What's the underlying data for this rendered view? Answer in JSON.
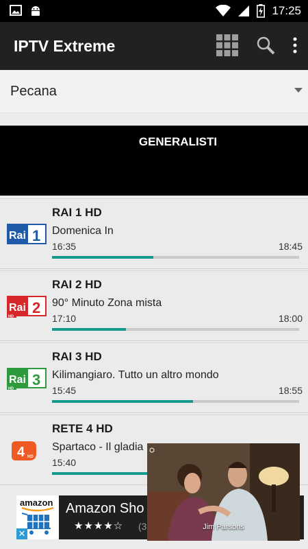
{
  "status_bar": {
    "time": "17:25",
    "icons": [
      "image-icon",
      "android-icon",
      "wifi-icon",
      "signal-icon",
      "battery-charging-icon"
    ]
  },
  "app_bar": {
    "title": "IPTV Extreme",
    "actions": [
      "grid-view-icon",
      "search-icon",
      "overflow-menu-icon"
    ]
  },
  "spinner": {
    "selected": "Pecana"
  },
  "category": {
    "title": "GENERALISTI"
  },
  "channels": [
    {
      "logo": "Rai 1",
      "name": "RAI 1 HD",
      "program": "Domenica In",
      "start": "16:35",
      "end": "18:45",
      "progress": 0.41
    },
    {
      "logo": "Rai 2",
      "name": "RAI 2 HD",
      "program": "90° Minuto Zona mista",
      "start": "17:10",
      "end": "18:00",
      "progress": 0.3
    },
    {
      "logo": "Rai 3",
      "name": "RAI 3 HD",
      "program": "Kilimangiaro. Tutto un altro mondo",
      "start": "15:45",
      "end": "18:55",
      "progress": 0.57
    },
    {
      "logo": "Rete 4",
      "name": "RETE 4 HD",
      "program": "Spartaco - Il gladia",
      "start": "15:40",
      "end": "",
      "progress": 0.45
    }
  ],
  "ad": {
    "brand": "amazon",
    "title": "Amazon Sho",
    "stars": "★★★★☆",
    "rating_count": "(3"
  },
  "video_overlay": {
    "caption": "Jim Parsons"
  },
  "colors": {
    "accent": "#14998a",
    "appbar": "#212121",
    "rai_blue": "#1e5aa8",
    "rai_red": "#d7272b",
    "rai_green": "#2e9a3e",
    "rete4_orange": "#ef5a24"
  }
}
